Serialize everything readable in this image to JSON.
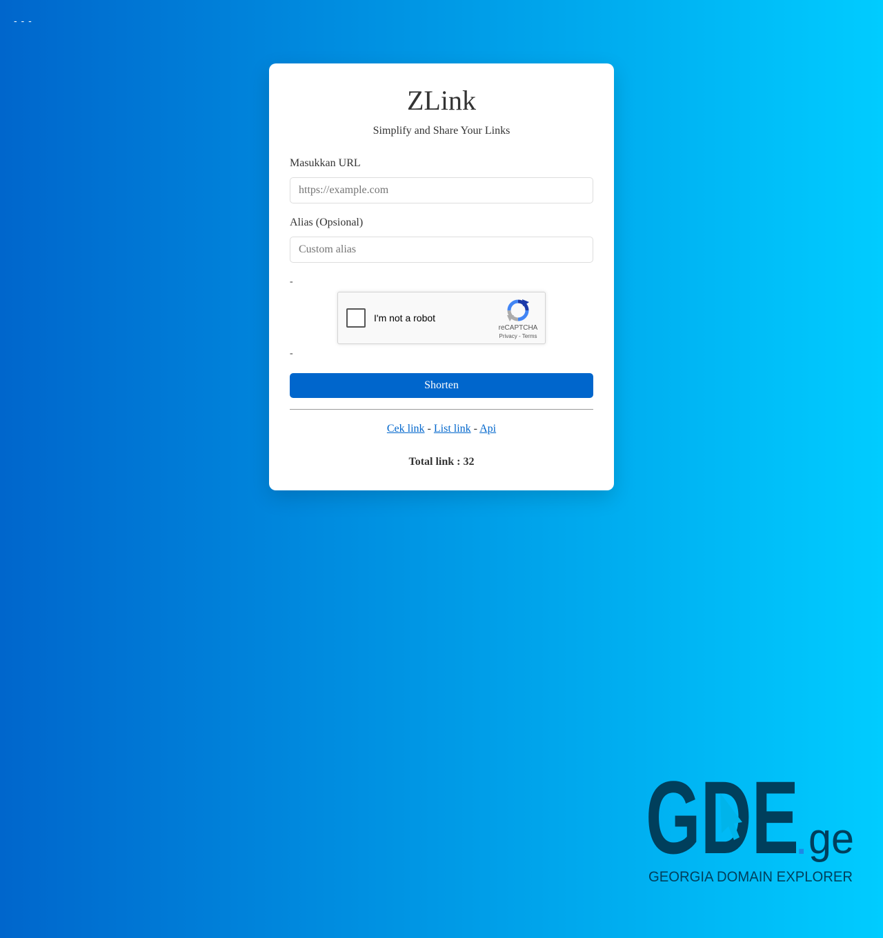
{
  "header": {
    "dashes": "- - -"
  },
  "app": {
    "title": "ZLink",
    "subtitle": "Simplify and Share Your Links"
  },
  "form": {
    "url_label": "Masukkan URL",
    "url_placeholder": "https://example.com",
    "url_value": "",
    "alias_label": "Alias (Opsional)",
    "alias_placeholder": "Custom alias",
    "alias_value": "",
    "dash_above": "-",
    "dash_below": "-",
    "submit_label": "Shorten"
  },
  "recaptcha": {
    "checkbox_icon": "checkbox-empty-icon",
    "label": "I'm not a robot",
    "logo_icon": "recaptcha-logo-icon",
    "brand": "reCAPTCHA",
    "privacy": "Privacy",
    "separator": " - ",
    "terms": "Terms"
  },
  "links": {
    "cek_link": "Cek link",
    "separator_1": " - ",
    "list_link": "List link",
    "separator_2": " - ",
    "api": "Api"
  },
  "stats": {
    "total_label": "Total link : 32"
  },
  "footer_logo": {
    "name_main": "GDE",
    "name_dot": ".",
    "name_tld": "ge",
    "tagline": "GEORGIA DOMAIN EXPLORER",
    "pointer_icon": "cursor-arrow-icon"
  },
  "colors": {
    "background_start": "#0066cc",
    "background_end": "#00ccff",
    "accent": "#0066cc",
    "logo_dark": "#003f5c",
    "logo_dot": "#1e88e5"
  }
}
